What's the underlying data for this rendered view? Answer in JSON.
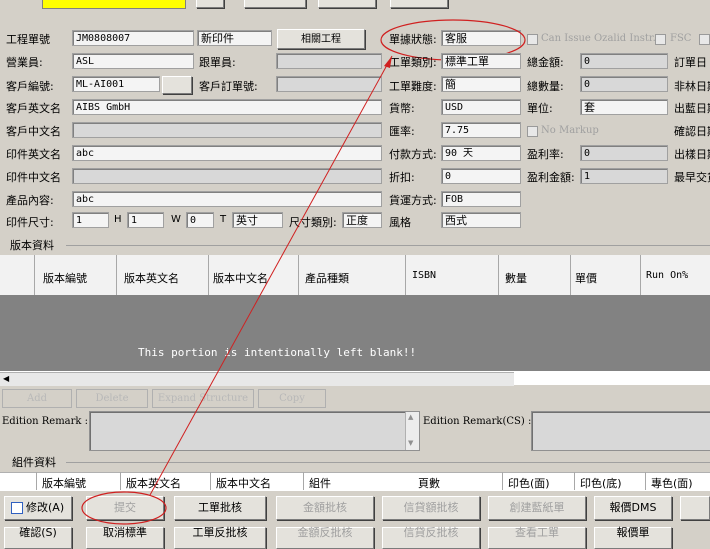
{
  "toolbar": {
    "b1_label": "",
    "b2_label": "",
    "b3_label": "",
    "b4_label": ""
  },
  "form": {
    "job_no": {
      "label": "工程單號",
      "value": "JM0808007"
    },
    "new_print": "新印件",
    "engineering": "相關工程",
    "status": {
      "label": "單據狀態:",
      "value": "客服"
    },
    "can_issue": "Can Issue Ozalid Instr.",
    "fsc": "FSC",
    "sales": {
      "label": "營業員:",
      "value": "ASL"
    },
    "follower": {
      "label": "跟單員:",
      "value": ""
    },
    "order_type": {
      "label": "工單類別:",
      "value": "標準工單"
    },
    "total_amount": {
      "label": "總金額:",
      "value": "0"
    },
    "order_date_lbl": "訂單日",
    "client_code": {
      "label": "客戶編號:",
      "value": "ML-AI001"
    },
    "client_order": {
      "label": "客戶訂單號:",
      "value": ""
    },
    "difficulty": {
      "label": "工單難度:",
      "value": "簡"
    },
    "total_qty": {
      "label": "總數量:",
      "value": "0"
    },
    "non_forest_lbl": "非林日期",
    "client_en": {
      "label": "客戶英文名",
      "value": "AIBS GmbH"
    },
    "currency": {
      "label": "貨幣:",
      "value": "USD"
    },
    "unit": {
      "label": "單位:",
      "value": "套"
    },
    "blue_date_lbl": "出藍日期",
    "client_cn": {
      "label": "客戶中文名",
      "value": ""
    },
    "rate": {
      "label": "匯率:",
      "value": "7.75"
    },
    "no_markup": "No Markup",
    "confirm_date_lbl": "確認日期",
    "print_en": {
      "label": "印件英文名",
      "value": "abc"
    },
    "payment": {
      "label": "付款方式:",
      "value": "90 天"
    },
    "profit_rate": {
      "label": "盈利率:",
      "value": "0"
    },
    "sample_date_lbl": "出樣日期",
    "print_cn": {
      "label": "印件中文名",
      "value": ""
    },
    "discount": {
      "label": "折扣:",
      "value": "0"
    },
    "profit_amount": {
      "label": "盈利金額:",
      "value": "1"
    },
    "final_date_lbl": "最早交貨",
    "product": {
      "label": "產品內容:",
      "value": "abc"
    },
    "shipping": {
      "label": "貨運方式:",
      "value": "FOB"
    },
    "size": {
      "label": "印件尺寸:",
      "l": "1",
      "h_label": "H",
      "h": "1",
      "w_label": "W",
      "w": "0",
      "t_label": "T",
      "unit": "英寸",
      "cat_label": "尺寸類別:",
      "cat": "正度"
    },
    "style": {
      "label": "風格",
      "value": "西式"
    }
  },
  "edition": {
    "section": "版本資料",
    "headers": [
      "版本編號",
      "版本英文名",
      "版本中文名",
      "產品種類",
      "ISBN",
      "數量",
      "單價",
      "Run On%"
    ],
    "blank_note": "This portion is intentionally left blank!!",
    "buttons": [
      "Add",
      "Delete",
      "Expand Structure",
      "Copy"
    ],
    "remark_label": "Edition Remark :",
    "remark_cs_label": "Edition Remark(CS) :"
  },
  "component": {
    "section": "組件資料",
    "headers": [
      "版本編號",
      "版本英文名",
      "版本中文名",
      "組件",
      "頁數",
      "印色(面)",
      "印色(底)",
      "專色(面)"
    ]
  },
  "bottom_buttons": [
    "修改(A)",
    "提交",
    "工單批核",
    "金額批核",
    "信貸額批核",
    "創建藍紙單",
    "報價DMS"
  ],
  "bottom_row2": [
    "確認(S)",
    "取消標準",
    "工單反批核",
    "金額反批核",
    "信貸反批核",
    "查看工單",
    "報價單"
  ]
}
